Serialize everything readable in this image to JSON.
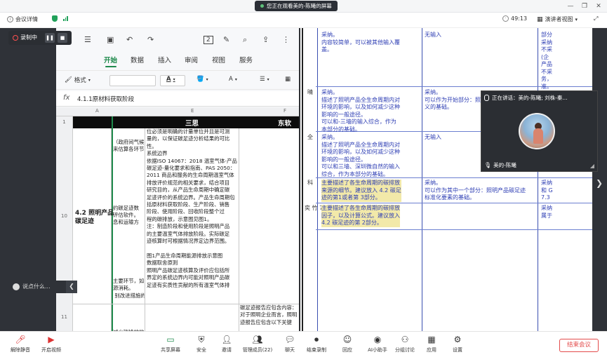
{
  "titlebar": {
    "share_notice": "您正在观看美的-陈曦的屏幕"
  },
  "header": {
    "meeting_details": "会议详情",
    "timer": "49:13",
    "view_mode": "演讲者视图"
  },
  "recording": {
    "label": "录制中"
  },
  "spreadsheet": {
    "tabs": [
      "开始",
      "数据",
      "插入",
      "审阅",
      "视图",
      "服务"
    ],
    "active_tab": "开始",
    "toolbar": {
      "format_label": "格式",
      "font_color": "A",
      "text_size": "A"
    },
    "toolbar_page_number": "2",
    "formula": "4.1.1原材料获取阶段",
    "column_headers": [
      "A",
      "E",
      "F"
    ],
    "row_numbers": [
      "1",
      "10",
      "11"
    ],
    "header_row": {
      "center": "三思",
      "right": "东软"
    },
    "row10_label": "4.2 照明产品\n碳足迹",
    "col_b_fragments": "（政府间气候\n来估算各环节\n\n\n\n\n\n\n\n约碳足迹数\n评估软件。\n息和运输方\n\n\n\n\n\n\n\n主要环节，如\n源消耗。\n 别改进措施的\n\n\n\n\n减少碳排放的\n能源或改进产\n\n开发、市场营",
    "col_e_text": "位必须是明确的计量单位并且是可测\n量的，以保证碳足迹分析结果的可比\n性。\n系统边界\n依据ISO 14067：2018 温室气体-产品\n碳足迹-量化要求和指南、PAS 2050：\n2011 商品和服务的生命周期温室气体\n排放评价规范的相关要求，结合项目\n研究目的，从产品生命周期中确定碳\n足迹评价的系统边界。产品生命周期包\n括原材料获取阶段、生产阶段、销售\n阶段、使用阶段、回收阶段整个过\n程的碳排放，示意图见图1。\n注：制造阶段和使用阶段是照明产品\n的主要温室气体排放阶段。实际碳足\n迹核算时可根据情况界定边界范围。\n\n图1产品生命周期能源排放示意图\n数据取舍原则\n照明产品碳足迹核算及评价应包括所\n界定的系统边界内可能对照明产品碳\n足迹有实质性贡献的所有温室气体排",
    "col_f_text": "碳足迹报告应包含内容：\n对于照明企业而言，照明\n迹报告应包含以下关键"
  },
  "review_table": {
    "rows": [
      {
        "label": "",
        "c1": "采纳。\n内容较简单，可以被其他输入覆\n盖。",
        "c2": "无输入",
        "c3": "部分\n采纳\n不采\n(企\n产品\n不采\n务，\n准。"
      },
      {
        "label": "晴",
        "c1": "采纳。\n描述了照明产品全生命周期内对\n环境的影响，以及如何减少这种\n影响的一般途径。\n可以和-三墙的输入综合，作为\n本部分的基础。",
        "c2": "采纳。\n可以作为开始部分：照\n义的基础。",
        "c3": ""
      },
      {
        "label": "全",
        "c1": "采纳。\n描述了照明产品全生命周期内对\n环境的影响，以及如何减少这种\n影响的一般途径。\n可以和三墙、深圳微自然的输入\n综合，作为本部分的基础。",
        "c2": "无输入",
        "c3": ""
      },
      {
        "label": "科",
        "c1": "主要描述了各生命周期的碳排放\n来源的细节。建议放入 4.2 碳足\n迹的第1或者第 3部分。",
        "c2": "采纳。\n可以作为其中一个部分：照明产品碳足迹\n标准化要素的基础。",
        "c3": "采纳\n和 G\n7.3"
      },
      {
        "label": "奕\n\n竹\n748\n@q\nom",
        "c1": "主要描述了各生命周期的碳排放\n因子，以及计算公式。建议放入\n4.2 碳足迹的第 2部分。",
        "c2": "",
        "c3": "采纳\n属于"
      }
    ]
  },
  "speaker": {
    "speaking_label": "正在讲话：美的-陈曦; 刘株-秦...",
    "name": "美的-陈曦"
  },
  "chat": {
    "placeholder": "说点什么..."
  },
  "toolbar": {
    "items": [
      {
        "label": "解除静音",
        "icon": "mic-muted-icon"
      },
      {
        "label": "开启视频",
        "icon": "video-off-icon"
      },
      {
        "label": "共享屏幕",
        "icon": "screen-share-icon"
      },
      {
        "label": "安全",
        "icon": "shield-icon"
      },
      {
        "label": "邀请",
        "icon": "invite-icon"
      },
      {
        "label": "管理成员(22)",
        "icon": "members-icon"
      },
      {
        "label": "聊天",
        "icon": "chat-icon"
      },
      {
        "label": "结束录制",
        "icon": "record-stop-icon"
      },
      {
        "label": "回应",
        "icon": "reaction-icon"
      },
      {
        "label": "AI小助手",
        "icon": "ai-icon"
      },
      {
        "label": "分组讨论",
        "icon": "breakout-icon"
      },
      {
        "label": "应用",
        "icon": "apps-icon"
      },
      {
        "label": "设置",
        "icon": "settings-icon"
      }
    ],
    "end_meeting": "结束会议"
  },
  "colors": {
    "accent_green": "#1f8a4c",
    "link_blue": "#2f3fb4",
    "end_red": "#e34b4b",
    "highlight": "#f2e9a9"
  }
}
